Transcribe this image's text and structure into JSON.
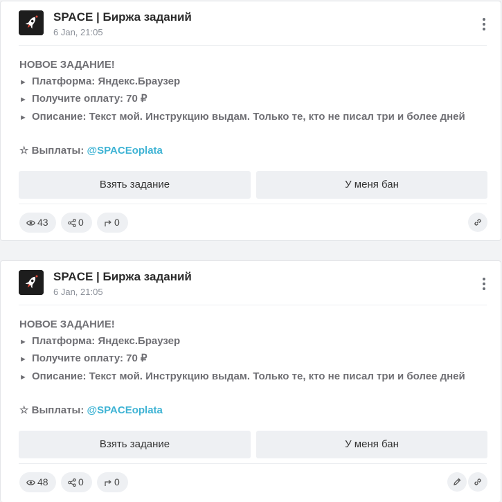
{
  "posts": [
    {
      "channel": "SPACE | Биржа заданий",
      "time": "6 Jan, 21:05",
      "heading": "НОВОЕ ЗАДАНИЕ!",
      "bullets": [
        "Платформа: Яндекс.Браузер",
        "Получите оплату: 70 ₽",
        "Описание: Текст мой. Инструкцию выдам. Только те, кто не писал три и более дней"
      ],
      "payments_label": "☆ Выплаты: ",
      "payments_link": "@SPACEoplata",
      "button_take": "Взять задание",
      "button_ban": "У меня бан",
      "views": "43",
      "shares": "0",
      "forwards": "0"
    },
    {
      "channel": "SPACE | Биржа заданий",
      "time": "6 Jan, 21:05",
      "heading": "НОВОЕ ЗАДАНИЕ!",
      "bullets": [
        "Платформа: Яндекс.Браузер",
        "Получите оплату: 70 ₽",
        "Описание: Текст мой. Инструкцию выдам. Только те, кто не писал три и более дней"
      ],
      "payments_label": "☆ Выплаты: ",
      "payments_link": "@SPACEoplata",
      "button_take": "Взять задание",
      "button_ban": "У меня бан",
      "views": "48",
      "shares": "0",
      "forwards": "0"
    }
  ],
  "icons": {
    "avatar": "rocket-icon",
    "menu": "more-vertical-icon",
    "views": "eye-icon",
    "shares": "share-icon",
    "forwards": "forward-icon",
    "link": "link-icon",
    "edit": "pencil-icon"
  },
  "colors": {
    "link": "#3eb3d4",
    "button_bg": "#eef0f3",
    "text_muted": "#6f6f74"
  }
}
